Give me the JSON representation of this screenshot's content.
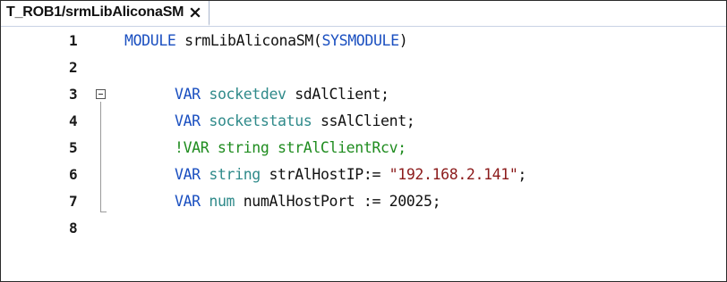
{
  "tab": {
    "title": "T_ROB1/srmLibAliconaSM",
    "close_icon": "close-icon"
  },
  "colors": {
    "keyword": "#1a4fc0",
    "type": "#2f8a8a",
    "string": "#8b1a1a",
    "comment": "#1f8c1f",
    "text": "#111111"
  },
  "lines": [
    {
      "number": "1",
      "tokens": [
        "MODULE",
        " ",
        "srmLibAliconaSM",
        "(",
        "SYSMODULE",
        ")"
      ]
    },
    {
      "number": "2",
      "tokens": []
    },
    {
      "number": "3",
      "tokens": [
        "VAR",
        " ",
        "socketdev",
        " ",
        "sdAlClient;"
      ]
    },
    {
      "number": "4",
      "tokens": [
        "VAR",
        " ",
        "socketstatus",
        " ",
        "ssAlClient;"
      ]
    },
    {
      "number": "5",
      "tokens": [
        "!VAR string strAlClientRcv;"
      ]
    },
    {
      "number": "6",
      "tokens": [
        "VAR",
        " ",
        "string",
        " ",
        "strAlHostIP:= ",
        "\"192.168.2.141\"",
        ";"
      ]
    },
    {
      "number": "7",
      "tokens": [
        "VAR",
        " ",
        "num",
        " ",
        "numAlHostPort := 20025;"
      ]
    },
    {
      "number": "8",
      "tokens": []
    }
  ]
}
